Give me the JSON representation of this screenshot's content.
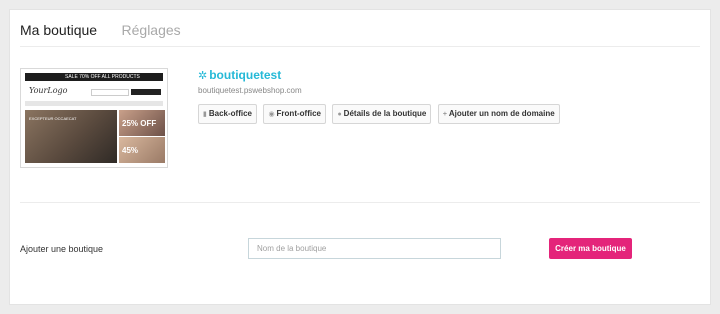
{
  "tabs": [
    {
      "label": "Ma boutique",
      "active": true
    },
    {
      "label": "Réglages",
      "active": false
    }
  ],
  "shop": {
    "name": "boutiquetest",
    "url": "boutiquetest.pswebshop.com",
    "thumbnail": {
      "banner_text": "SALE 70% OFF ALL PRODUCTS",
      "logo_text": "YourLogo",
      "hero_text": "EXCEPTEUR OCCAECAT",
      "promo1_text": "25% OFF",
      "promo2_text": "45%"
    },
    "icon": "gear-icon"
  },
  "actions": [
    {
      "label": "Back-office",
      "icon": "bookmark-icon",
      "glyph": "▮"
    },
    {
      "label": "Front-office",
      "icon": "eye-icon",
      "glyph": "◉"
    },
    {
      "label": "Détails de la boutique",
      "icon": "info-icon",
      "glyph": "●"
    },
    {
      "label": "Ajouter un nom de domaine",
      "icon": "plus-icon",
      "glyph": "+"
    }
  ],
  "add_shop": {
    "label": "Ajouter une boutique",
    "placeholder": "Nom de la boutique",
    "value": "",
    "button_label": "Créer ma boutique"
  },
  "colors": {
    "accent": "#25b9d7",
    "primary_button": "#e4247a"
  }
}
